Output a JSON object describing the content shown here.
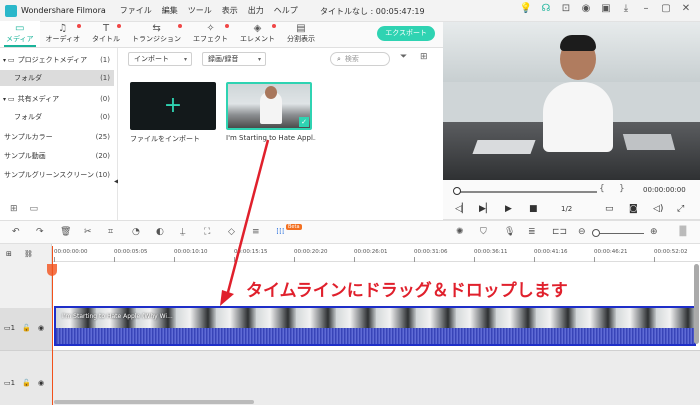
{
  "titlebar": {
    "app_name": "Wondershare Filmora",
    "menus": [
      "ファイル",
      "編集",
      "ツール",
      "表示",
      "出力",
      "ヘルプ"
    ],
    "window_title": "タイトルなし : 00:05:47:19"
  },
  "toolbar": {
    "tabs": [
      {
        "label": "メディア",
        "icon": "folder-icon",
        "active": true,
        "dot": false
      },
      {
        "label": "オーディオ",
        "icon": "music-note-icon",
        "active": false,
        "dot": true
      },
      {
        "label": "タイトル",
        "icon": "text-icon",
        "active": false,
        "dot": true
      },
      {
        "label": "トランジション",
        "icon": "transition-icon",
        "active": false,
        "dot": true
      },
      {
        "label": "エフェクト",
        "icon": "effects-icon",
        "active": false,
        "dot": true
      },
      {
        "label": "エレメント",
        "icon": "elements-icon",
        "active": false,
        "dot": true
      },
      {
        "label": "分割表示",
        "icon": "split-screen-icon",
        "active": false,
        "dot": false
      }
    ],
    "export_label": "エクスポート"
  },
  "sidebar": {
    "items": [
      {
        "label": "プロジェクトメディア",
        "count": "(1)"
      },
      {
        "label": "フォルダ",
        "count": "(1)"
      },
      {
        "label": "共有メディア",
        "count": "(0)"
      },
      {
        "label": "フォルダ",
        "count": "(0)"
      },
      {
        "label": "サンプルカラー",
        "count": "(25)"
      },
      {
        "label": "サンプル動画",
        "count": "(20)"
      },
      {
        "label": "サンプルグリーンスクリーン",
        "count": "(10)"
      }
    ]
  },
  "media": {
    "import_dropdown": "インポート",
    "record_dropdown": "録画/録音",
    "search_placeholder": "検索",
    "import_caption": "ファイルをインポート",
    "clip_caption": "I'm Starting to Hate Appl..."
  },
  "preview": {
    "time": "00:00:00:00",
    "ratio": "1/2"
  },
  "timeline": {
    "ticks": [
      "00:00:00:00",
      "00:00:05:05",
      "00:00:10:10",
      "00:00:15:15",
      "00:00:20:20",
      "00:00:26:01",
      "00:00:31:06",
      "00:00:36:11",
      "00:00:41:16",
      "00:00:46:21",
      "00:00:52:02"
    ],
    "clip_label": "I'm Starting to Hate Apple (Why Wi..."
  },
  "annotation": {
    "text": "タイムラインにドラッグ＆ドロップします"
  },
  "colors": {
    "accent": "#1ab39a",
    "annotation": "#e0202c",
    "clip_border": "#1e2ec8"
  }
}
